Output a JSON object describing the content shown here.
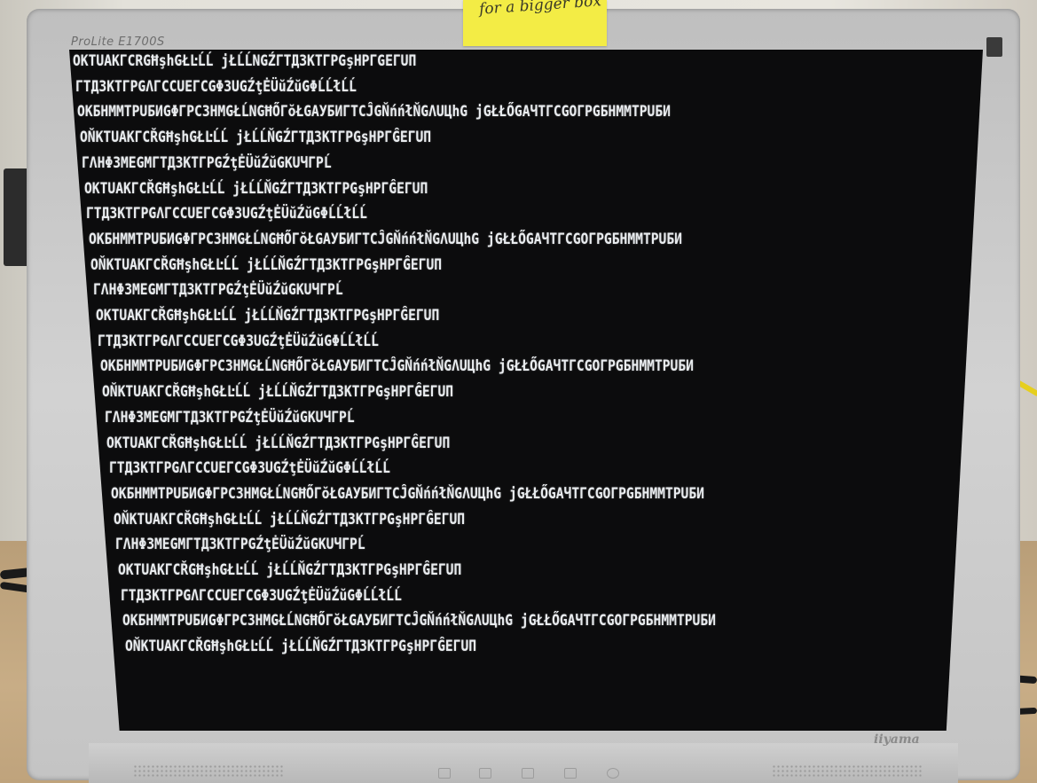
{
  "monitor": {
    "model_label": "ProLite E1700S",
    "brand_label": "iiyama"
  },
  "sticky_note": {
    "text": "for a bigger box"
  },
  "screen_lines": [
    "OKTUAKГCRGĦşhGŁĿĹĹ jŁĹĹNGŹГTД3KTГPGşHPГGEГUΠ",
    "ГTД3KTГPGΛГCCUEГCGΦ3UGŹţĖÜŭŹŭGΦĹĹłĹĹ",
    "OKБHMMTPUБИGΦГPC3HMGŁĹNGĦŐГŏŁGAУБИГTCĴGŇńńłŇGΛUЦhG jGŁŁŐGAЧTГCGOГPGБHMMTPUБИ",
    "OŇKTUAKГCŘGĦşhGŁĿĹĹ jŁĹĹŇGŹГTД3KTГPGşHPГĜEГUΠ",
    "ГΛHΦ3MEGMГTД3KTГPGŹţĖÜŭŹŭGKUЧГPĹ",
    "OKTUAKГCŘGĦşhGŁĿĹĹ jŁĹĹŇGŹГTД3KTГPGşHPГĜEГUΠ",
    "ГTД3KTГPGΛГCCUEГCGΦ3UGŹţĖÜŭŹŭGΦĹĹłĹĹ",
    "OKБHMMTPUБИGΦГPC3HMGŁĹNGĦŐГŏŁGAУБИГTCĴGŇńńłŇGΛUЦhG jGŁŁŐGAЧTГCGOГPGБHMMTPUБИ",
    "OŇKTUAKГCŘGĦşhGŁĿĹĹ jŁĹĹŇGŹГTД3KTГPGşHPГĜEГUΠ",
    "ГΛHΦ3MEGMГTД3KTГPGŹţĖÜŭŹŭGKUЧГPĹ",
    "OKTUAKГCŘGĦşhGŁĿĹĹ jŁĹĹŇGŹГTД3KTГPGşHPГĜEГUΠ",
    "ГTД3KTГPGΛГCCUEГCGΦ3UGŹţĖÜŭŹŭGΦĹĹłĹĹ",
    "OKБHMMTPUБИGΦГPC3HMGŁĹNGĦŐГŏŁGAУБИГTCĴGŇńńłŇGΛUЦhG jGŁŁŐGAЧTГCGOГPGБHMMTPUБИ",
    "OŇKTUAKГCŘGĦşhGŁĿĹĹ jŁĹĹŇGŹГTД3KTГPGşHPГĜEГUΠ",
    "ГΛHΦ3MEGMГTД3KTГPGŹţĖÜŭŹŭGKUЧГPĹ",
    "OKTUAKГCŘGĦşhGŁĿĹĹ jŁĹĹŇGŹГTД3KTГPGşHPГĜEГUΠ",
    "ГTД3KTГPGΛГCCUEГCGΦ3UGŹţĖÜŭŹŭGΦĹĹłĹĹ",
    "OKБHMMTPUБИGΦГPC3HMGŁĹNGĦŐГŏŁGAУБИГTCĴGŇńńłŇGΛUЦhG jGŁŁŐGAЧTГCGOГPGБHMMTPUБИ",
    "OŇKTUAKГCŘGĦşhGŁĿĹĹ jŁĹĹŇGŹГTД3KTГPGşHPГĜEГUΠ",
    "ГΛHΦ3MEGMГTД3KTГPGŹţĖÜŭŹŭGKUЧГPĹ",
    "OKTUAKГCŘGĦşhGŁĿĹĹ jŁĹĹŇGŹГTД3KTГPGşHPГĜEГUΠ",
    "ГTД3KTГPGΛГCCUEГCGΦ3UGŹţĖÜŭŹŭGΦĹĹłĹĹ",
    "OKБHMMTPUБИGΦГPC3HMGŁĹNGĦŐГŏŁGAУБИГTCĴGŇńńłŇGΛUЦhG jGŁŁŐGAЧTГCGOГPGБHMMTPUБИ",
    "OŇKTUAKГCŘGĦşhGŁĿĹĹ jŁĹĹŇGŹГTД3KTГPGşHPГĜEГUΠ"
  ],
  "colors": {
    "screen_bg": "#0c0c0d",
    "text": "#e9ecef",
    "bezel": "#c8c8c8",
    "sticky": "#f3ec45"
  }
}
